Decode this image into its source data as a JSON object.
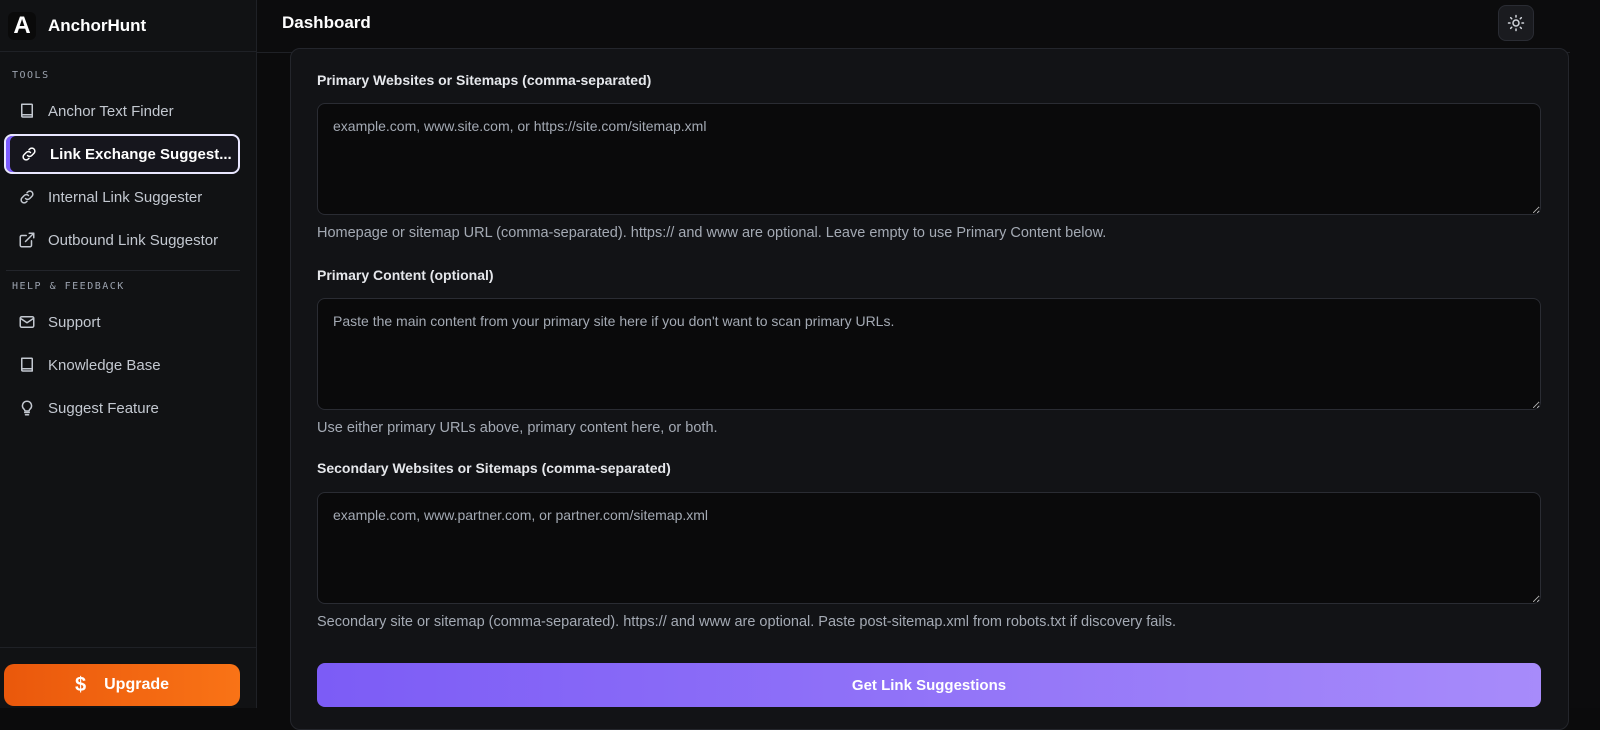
{
  "brand": {
    "logo_letter": "A",
    "name": "AnchorHunt"
  },
  "header": {
    "title": "Dashboard",
    "theme_icon": "sun-icon"
  },
  "sidebar": {
    "tools_label": "TOOLS",
    "tools": [
      {
        "label": "Anchor Text Finder",
        "icon": "book-icon"
      },
      {
        "label": "Link Exchange Suggest...",
        "icon": "link-icon",
        "active": true
      },
      {
        "label": "Internal Link Suggester",
        "icon": "link-icon"
      },
      {
        "label": "Outbound Link Suggestor",
        "icon": "external-link-icon"
      }
    ],
    "help_label": "HELP & FEEDBACK",
    "help": [
      {
        "label": "Support",
        "icon": "mail-icon"
      },
      {
        "label": "Knowledge Base",
        "icon": "book-icon"
      },
      {
        "label": "Suggest Feature",
        "icon": "lightbulb-icon"
      }
    ],
    "upgrade": {
      "label": "Upgrade",
      "icon_glyph": "$"
    }
  },
  "form": {
    "primary_urls": {
      "label": "Primary Websites or Sitemaps (comma-separated)",
      "placeholder": "example.com, www.site.com, or https://site.com/sitemap.xml",
      "value": "",
      "help": "Homepage or sitemap URL (comma-separated). https:// and www are optional. Leave empty to use Primary Content below."
    },
    "primary_content": {
      "label": "Primary Content (optional)",
      "placeholder": "Paste the main content from your primary site here if you don't want to scan primary URLs.",
      "value": "",
      "help": "Use either primary URLs above, primary content here, or both."
    },
    "secondary_urls": {
      "label": "Secondary Websites or Sitemaps (comma-separated)",
      "placeholder": "example.com, www.partner.com, or partner.com/sitemap.xml",
      "value": "",
      "help": "Secondary site or sitemap (comma-separated). https:// and www are optional. Paste post-sitemap.xml from robots.txt if discovery fails."
    },
    "submit_label": "Get Link Suggestions"
  },
  "colors": {
    "accent": "#7c5cf6",
    "upgrade": "#f97316",
    "background": "#0b0b0c"
  }
}
